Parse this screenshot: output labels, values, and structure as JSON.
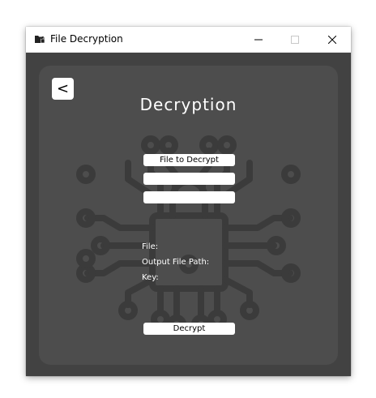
{
  "window": {
    "title": "File Decryption",
    "icons": {
      "app": "folder-lock-icon",
      "minimize": "minimize-icon",
      "maximize": "maximize-icon",
      "close": "close-icon"
    }
  },
  "panel": {
    "back_label": "<",
    "heading": "Decryption",
    "background_icon": "circuit-board-lock-icon",
    "file_button_label": "File to Decrypt",
    "output_path_value": "",
    "key_value": "",
    "info": {
      "file_label": "File:",
      "output_label": "Output File Path:",
      "key_label": "Key:"
    },
    "decrypt_label": "Decrypt"
  },
  "colors": {
    "window_bg": "#424242",
    "panel_bg": "#4d4d4d",
    "circuit": "#3a3a3a",
    "text": "#ffffff"
  }
}
